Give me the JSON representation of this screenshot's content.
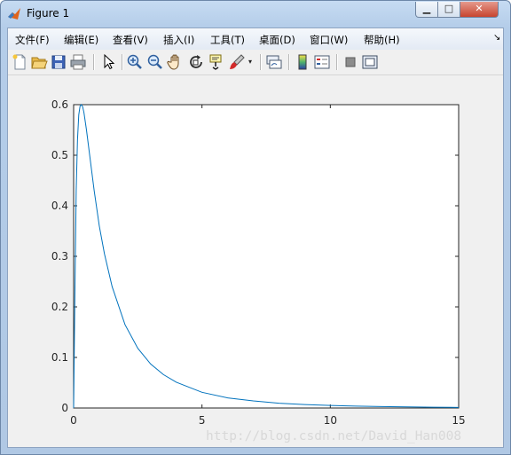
{
  "window": {
    "title": "Figure 1"
  },
  "menu": [
    {
      "label": "文件(F)"
    },
    {
      "label": "编辑(E)"
    },
    {
      "label": "查看(V)"
    },
    {
      "label": "插入(I)"
    },
    {
      "label": "工具(T)"
    },
    {
      "label": "桌面(D)"
    },
    {
      "label": "窗口(W)"
    },
    {
      "label": "帮助(H)"
    }
  ],
  "toolbar": {
    "icons": [
      "new-figure-icon",
      "open-folder-icon",
      "save-icon",
      "print-icon",
      "pointer-icon",
      "zoom-in-icon",
      "zoom-out-icon",
      "pan-hand-icon",
      "rotate-3d-icon",
      "data-cursor-icon",
      "brush-icon",
      "link-plot-icon",
      "colorbar-icon",
      "legend-icon",
      "hide-plot-tools-icon",
      "show-plot-tools-icon"
    ]
  },
  "chart_data": {
    "type": "line",
    "title": "",
    "xlabel": "",
    "ylabel": "",
    "xlim": [
      0,
      15
    ],
    "ylim": [
      0,
      0.6
    ],
    "xticks": [
      "0",
      "5",
      "10",
      "15"
    ],
    "yticks": [
      "0",
      "0.1",
      "0.2",
      "0.3",
      "0.4",
      "0.5",
      "0.6"
    ],
    "grid": false,
    "series": [
      {
        "color": "#0072bd",
        "x": [
          0,
          0.05,
          0.1,
          0.15,
          0.2,
          0.25,
          0.3,
          0.35,
          0.4,
          0.5,
          0.6,
          0.7,
          0.8,
          1.0,
          1.2,
          1.5,
          2.0,
          2.5,
          3.0,
          3.5,
          4.0,
          5.0,
          6.0,
          7.0,
          8.0,
          9.0,
          10.0,
          11.0,
          12.0,
          13.0,
          14.0,
          15.0
        ],
        "y": [
          0,
          0.23,
          0.43,
          0.53,
          0.58,
          0.597,
          0.6,
          0.596,
          0.585,
          0.55,
          0.51,
          0.47,
          0.43,
          0.36,
          0.305,
          0.24,
          0.165,
          0.118,
          0.087,
          0.066,
          0.051,
          0.031,
          0.02,
          0.014,
          0.0095,
          0.0068,
          0.005,
          0.0037,
          0.0028,
          0.0021,
          0.0016,
          0.0012
        ]
      }
    ]
  },
  "watermark": "http://blog.csdn.net/David_Han008"
}
